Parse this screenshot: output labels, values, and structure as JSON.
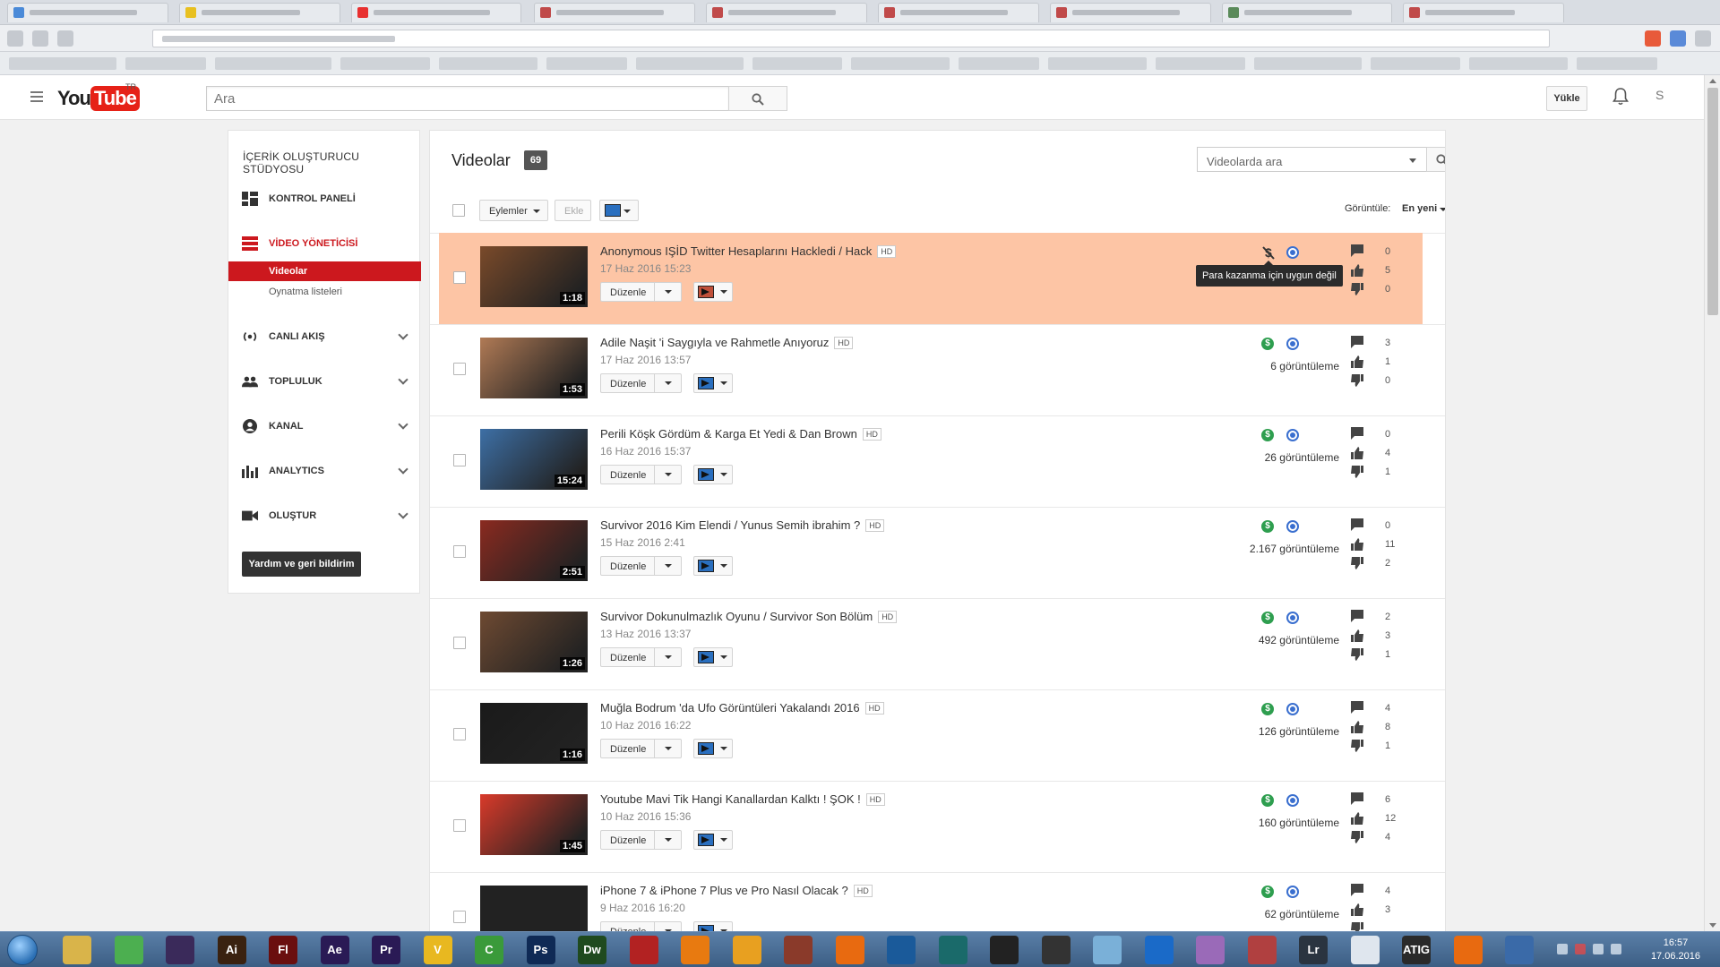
{
  "header": {
    "logo_you": "You",
    "logo_tube": "Tube",
    "logo_region": "TR",
    "search_placeholder": "Ara",
    "upload_label": "Yükle",
    "account_label": "S"
  },
  "sidebar": {
    "title": "İÇERİK OLUŞTURUCU STÜDYOSU",
    "dashboard": "KONTROL PANELİ",
    "video_manager": "VİDEO YÖNETİCİSİ",
    "sub_videos": "Videolar",
    "sub_playlists": "Oynatma listeleri",
    "live": "CANLI AKIŞ",
    "community": "TOPLULUK",
    "channel": "KANAL",
    "analytics": "ANALYTICS",
    "create": "OLUŞTUR",
    "help_button": "Yardım ve geri bildirim"
  },
  "main": {
    "title": "Videolar",
    "count": "69",
    "search_placeholder": "Videolarda ara",
    "actions_label": "Eylemler",
    "add_label": "Ekle",
    "sort_label": "Görüntüle:",
    "sort_value": "En yeni",
    "edit_label": "Düzenle",
    "hd_badge": "HD",
    "tooltip": "Para kazanma için uygun değil"
  },
  "videos": [
    {
      "title": "Anonymous IŞİD Twitter Hesaplarını Hackledi / Hack",
      "date": "17 Haz 2016 15:23",
      "duration": "1:18",
      "views": "",
      "comments": "0",
      "likes": "5",
      "dislikes": "0",
      "monetized": false,
      "thumb_color": "#7a4a2a"
    },
    {
      "title": "Adile Naşit 'i Saygıyla ve Rahmetle Anıyoruz",
      "date": "17 Haz 2016 13:57",
      "duration": "1:53",
      "views": "6 görüntüleme",
      "comments": "3",
      "likes": "1",
      "dislikes": "0",
      "monetized": true,
      "thumb_color": "#b07a55"
    },
    {
      "title": "Perili Köşk Gördüm & Karga Et Yedi & Dan Brown",
      "date": "16 Haz 2016 15:37",
      "duration": "15:24",
      "views": "26 görüntüleme",
      "comments": "0",
      "likes": "4",
      "dislikes": "1",
      "monetized": true,
      "thumb_color": "#3d6fa5"
    },
    {
      "title": "Survivor 2016 Kim Elendi / Yunus Semih ibrahim ?",
      "date": "15 Haz 2016 2:41",
      "duration": "2:51",
      "views": "2.167 görüntüleme",
      "comments": "0",
      "likes": "11",
      "dislikes": "2",
      "monetized": true,
      "thumb_color": "#8a2a20"
    },
    {
      "title": "Survivor Dokunulmazlık Oyunu / Survivor Son Bölüm",
      "date": "13 Haz 2016 13:37",
      "duration": "1:26",
      "views": "492 görüntüleme",
      "comments": "2",
      "likes": "3",
      "dislikes": "1",
      "monetized": true,
      "thumb_color": "#6e4a32"
    },
    {
      "title": "Muğla Bodrum 'da Ufo Görüntüleri Yakalandı 2016",
      "date": "10 Haz 2016 16:22",
      "duration": "1:16",
      "views": "126 görüntüleme",
      "comments": "4",
      "likes": "8",
      "dislikes": "1",
      "monetized": true,
      "thumb_color": "#1a1a1a"
    },
    {
      "title": "Youtube Mavi Tik Hangi Kanallardan Kalktı ! ŞOK !",
      "date": "10 Haz 2016 15:36",
      "duration": "1:45",
      "views": "160 görüntüleme",
      "comments": "6",
      "likes": "12",
      "dislikes": "4",
      "monetized": true,
      "thumb_color": "#d93a2a"
    },
    {
      "title": "iPhone 7 & iPhone 7 Plus ve Pro Nasıl Olacak ?",
      "date": "9 Haz 2016 16:20",
      "duration": "",
      "views": "62 görüntüleme",
      "comments": "4",
      "likes": "3",
      "dislikes": "",
      "monetized": true,
      "thumb_color": "#222222"
    }
  ],
  "taskbar": {
    "time": "16:57",
    "date": "17.06.2016",
    "apps": [
      {
        "icon": "explorer-icon",
        "label": "",
        "color": "#d9b44a"
      },
      {
        "icon": "chrome-icon",
        "label": "",
        "color": "#4caf50"
      },
      {
        "icon": "media-icon",
        "label": "",
        "color": "#3a2a5a"
      },
      {
        "icon": "illustrator-icon",
        "label": "Ai",
        "color": "#3a2210"
      },
      {
        "icon": "flash-icon",
        "label": "Fl",
        "color": "#6a0f0f"
      },
      {
        "icon": "aftereffects-icon",
        "label": "Ae",
        "color": "#2a1a55"
      },
      {
        "icon": "premiere-icon",
        "label": "Pr",
        "color": "#2a1a55"
      },
      {
        "icon": "vectorian-icon",
        "label": "V",
        "color": "#e8b820"
      },
      {
        "icon": "camtasia-icon",
        "label": "C",
        "color": "#3a9a3a"
      },
      {
        "icon": "photoshop-icon",
        "label": "Ps",
        "color": "#0f2a55"
      },
      {
        "icon": "dreamweaver-icon",
        "label": "Dw",
        "color": "#1f4a1f"
      },
      {
        "icon": "filezilla-icon",
        "label": "",
        "color": "#b22222"
      },
      {
        "icon": "vlc-icon",
        "label": "",
        "color": "#e87a10"
      },
      {
        "icon": "office-icon",
        "label": "",
        "color": "#e8a020"
      },
      {
        "icon": "cube-icon",
        "label": "",
        "color": "#8a3a2a"
      },
      {
        "icon": "player-icon",
        "label": "",
        "color": "#e86a10"
      },
      {
        "icon": "globe-app-icon",
        "label": "",
        "color": "#1a5a9a"
      },
      {
        "icon": "maya-icon",
        "label": "",
        "color": "#1a6a6a"
      },
      {
        "icon": "inkscape-icon",
        "label": "",
        "color": "#222"
      },
      {
        "icon": "obs-icon",
        "label": "",
        "color": "#333"
      },
      {
        "icon": "notes-icon",
        "label": "",
        "color": "#7ab0d8"
      },
      {
        "icon": "ie-icon",
        "label": "",
        "color": "#1a6ac8"
      },
      {
        "icon": "gallery-icon",
        "label": "",
        "color": "#9a6ab8"
      },
      {
        "icon": "camera-icon",
        "label": "",
        "color": "#b04040"
      },
      {
        "icon": "lightroom-icon",
        "label": "Lr",
        "color": "#2a3440"
      },
      {
        "icon": "calculator-icon",
        "label": "",
        "color": "#dfe6ee"
      },
      {
        "icon": "atig-icon",
        "label": "ATIG",
        "color": "#2a2a2a"
      },
      {
        "icon": "firefox-icon",
        "label": "",
        "color": "#e86a10"
      },
      {
        "icon": "torrent-icon",
        "label": "",
        "color": "#3a6aa8"
      }
    ]
  }
}
